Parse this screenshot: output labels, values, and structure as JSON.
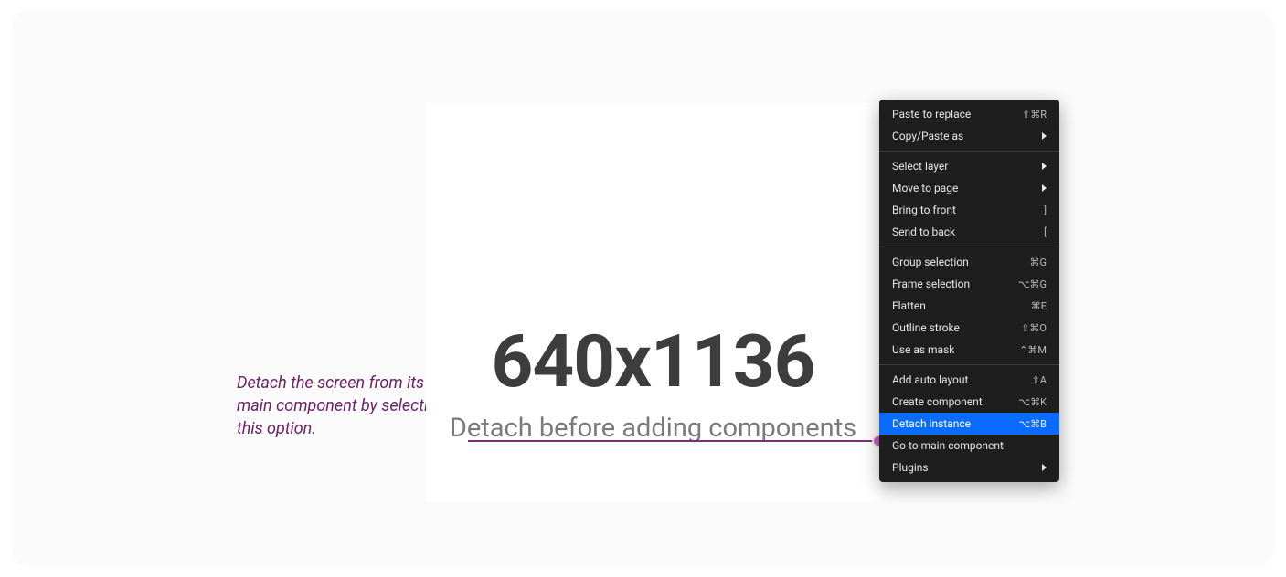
{
  "annotation": "Detach the screen from its main component by selecting this option.",
  "canvas": {
    "dimension_text": "640x1136",
    "subtitle": "Detach before adding components"
  },
  "menu": {
    "groups": [
      [
        {
          "label": "Paste to replace",
          "shortcut": "⇧⌘R"
        },
        {
          "label": "Copy/Paste as",
          "submenu": true
        }
      ],
      [
        {
          "label": "Select layer",
          "submenu": true
        },
        {
          "label": "Move to page",
          "submenu": true
        },
        {
          "label": "Bring to front",
          "shortcut": "]"
        },
        {
          "label": "Send to back",
          "shortcut": "["
        }
      ],
      [
        {
          "label": "Group selection",
          "shortcut": "⌘G"
        },
        {
          "label": "Frame selection",
          "shortcut": "⌥⌘G"
        },
        {
          "label": "Flatten",
          "shortcut": "⌘E"
        },
        {
          "label": "Outline stroke",
          "shortcut": "⇧⌘O"
        },
        {
          "label": "Use as mask",
          "shortcut": "⌃⌘M"
        }
      ],
      [
        {
          "label": "Add auto layout",
          "shortcut": "⇧A"
        },
        {
          "label": "Create component",
          "shortcut": "⌥⌘K"
        },
        {
          "label": "Detach instance",
          "shortcut": "⌥⌘B",
          "highlighted": true
        },
        {
          "label": "Go to main component"
        },
        {
          "label": "Plugins",
          "submenu": true
        }
      ]
    ]
  }
}
